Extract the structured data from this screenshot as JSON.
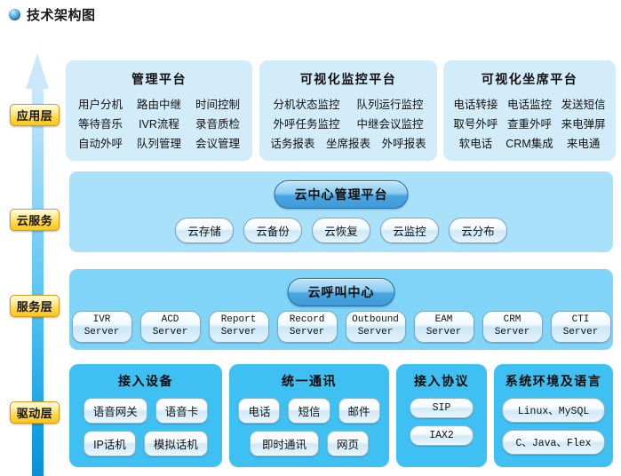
{
  "header": {
    "bullet_icon": "blue-sphere-bullet",
    "title": "技术架构图"
  },
  "arrow": {
    "icon": "up-arrow",
    "direction": "up"
  },
  "layers": [
    {
      "label": "应用层"
    },
    {
      "label": "云服务"
    },
    {
      "label": "服务层"
    },
    {
      "label": "驱动层"
    }
  ],
  "application_layer": {
    "panels": [
      {
        "title": "管理平台",
        "rows": [
          [
            "用户分机",
            "路由中继",
            "时间控制"
          ],
          [
            "等待音乐",
            "IVR流程",
            "录音质检"
          ],
          [
            "自动外呼",
            "队列管理",
            "会议管理"
          ]
        ]
      },
      {
        "title": "可视化监控平台",
        "rows": [
          [
            "分机状态监控",
            "队列运行监控"
          ],
          [
            "外呼任务监控",
            "中继会议监控"
          ],
          [
            "话务报表",
            "坐席报表",
            "外呼报表"
          ]
        ]
      },
      {
        "title": "可视化坐席平台",
        "rows": [
          [
            "电话转接",
            "电话监控",
            "发送短信"
          ],
          [
            "取号外呼",
            "查重外呼",
            "来电弹屏"
          ],
          [
            "软电话",
            "CRM集成",
            "来电通"
          ]
        ]
      }
    ]
  },
  "cloud_layer": {
    "hero": "云中心管理平台",
    "pills": [
      "云存储",
      "云备份",
      "云恢复",
      "云监控",
      "云分布"
    ]
  },
  "service_layer": {
    "hero": "云呼叫中心",
    "servers": [
      {
        "line1": "IVR",
        "line2": "Server"
      },
      {
        "line1": "ACD",
        "line2": "Server"
      },
      {
        "line1": "Report",
        "line2": "Server"
      },
      {
        "line1": "Record",
        "line2": "Server"
      },
      {
        "line1": "Outbound",
        "line2": "Server"
      },
      {
        "line1": "EAM",
        "line2": "Server"
      },
      {
        "line1": "CRM",
        "line2": "Server"
      },
      {
        "line1": "CTI",
        "line2": "Server"
      }
    ]
  },
  "driver_layer": {
    "panels": [
      {
        "title": "接入设备",
        "rows": [
          [
            "语音网关",
            "语音卡"
          ],
          [
            "IP话机",
            "模拟话机"
          ]
        ]
      },
      {
        "title": "统一通讯",
        "rows": [
          [
            "电话",
            "短信",
            "邮件"
          ],
          [
            "即时通讯",
            "网页"
          ]
        ]
      },
      {
        "title": "接入协议",
        "rows": [
          [
            "SIP"
          ],
          [
            "IAX2"
          ]
        ]
      },
      {
        "title": "系统环境及语言",
        "rows": [
          [
            "Linux、MySQL"
          ],
          [
            "C、Java、Flex"
          ]
        ]
      }
    ]
  },
  "colors": {
    "app_panel_bg": "#d2ecfa",
    "cloud_panel_bg": "#a9e0fa",
    "service_panel_bg": "#7fd4f8",
    "driver_panel_bg": "#3fc0f2",
    "layer_tab_yellow": "#ffd84a",
    "layer_tab_border": "#d99b17",
    "arrow_blue": "#17a3e8"
  }
}
